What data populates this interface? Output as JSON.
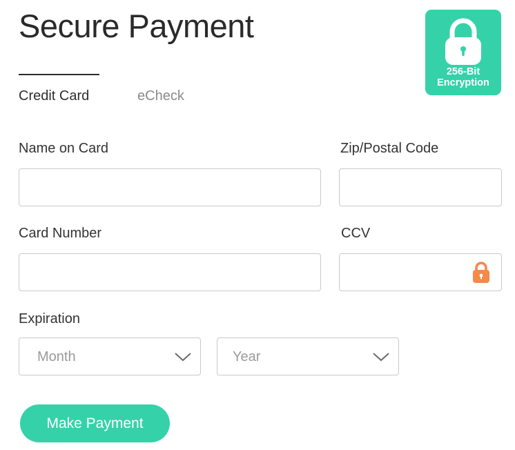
{
  "header": {
    "title": "Secure Payment",
    "badge": {
      "line1": "256-Bit",
      "line2": "Encryption",
      "icon": "lock-icon"
    }
  },
  "tabs": [
    {
      "label": "Credit Card",
      "active": true
    },
    {
      "label": "eCheck",
      "active": false
    }
  ],
  "form": {
    "name_on_card": {
      "label": "Name on Card",
      "value": ""
    },
    "zip": {
      "label": "Zip/Postal Code",
      "value": ""
    },
    "card_number": {
      "label": "Card Number",
      "value": ""
    },
    "ccv": {
      "label": "CCV",
      "value": "",
      "icon": "lock-icon"
    },
    "expiration": {
      "label": "Expiration",
      "month": {
        "value": "Month"
      },
      "year": {
        "value": "Year"
      }
    }
  },
  "submit": {
    "label": "Make Payment"
  },
  "colors": {
    "accent": "#35d2a9",
    "lock_orange": "#f5894a",
    "text": "#2a2a2a",
    "muted": "#9a9a9a",
    "border": "#c9c9c9"
  }
}
